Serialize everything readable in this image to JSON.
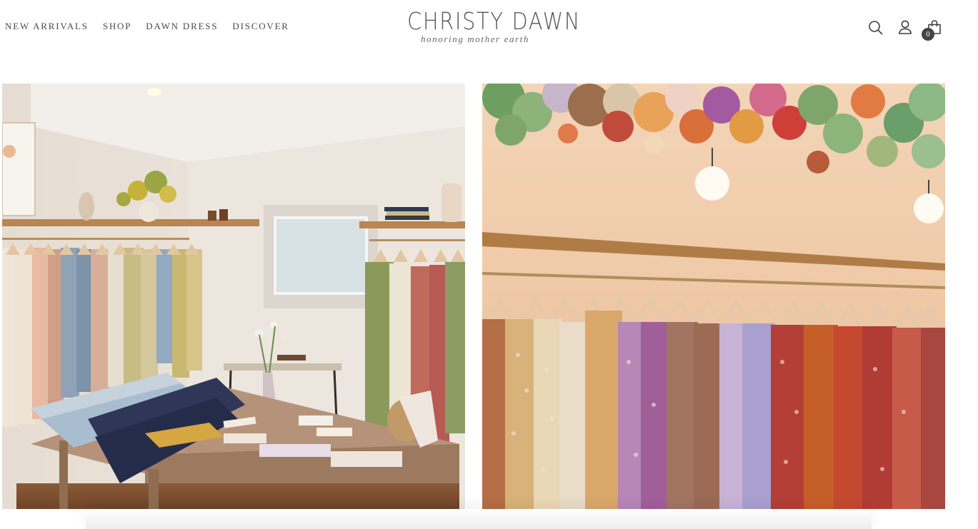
{
  "nav": {
    "items": [
      "NEW ARRIVALS",
      "SHOP",
      "DAWN DRESS",
      "DISCOVER"
    ]
  },
  "logo": {
    "title": "CHRISTY DAWN",
    "tagline": "honoring mother earth"
  },
  "header_icons": [
    "search-icon",
    "account-icon",
    "cart-icon"
  ],
  "cart": {
    "count": "0"
  },
  "colors": {
    "text": "#4a4a4a",
    "badge": "#4a4141",
    "wall": "#eee8df",
    "wood": "#b98550"
  }
}
